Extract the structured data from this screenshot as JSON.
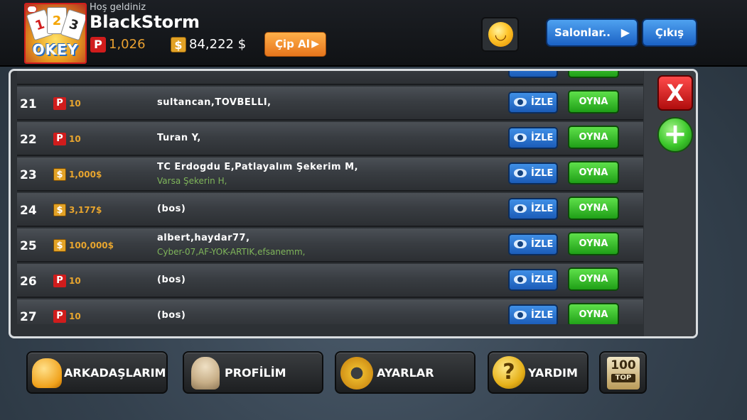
{
  "header": {
    "logo_text": "OKEY",
    "logo_cards": [
      "1",
      "2",
      "3"
    ],
    "welcome": "Hoş geldiniz",
    "username": "BlackStorm",
    "points_icon": "P",
    "points": "1,026",
    "money_icon": "$",
    "money": "84,222 $",
    "chip_button": "Çip Al",
    "salons_button": "Salonlar..",
    "logout_button": "Çıkış"
  },
  "tables": [
    {
      "num": "21",
      "currency": "P",
      "stake": "10",
      "players": "sultancan,TOVBELLI,",
      "watchers": ""
    },
    {
      "num": "22",
      "currency": "P",
      "stake": "10",
      "players": "Turan Y,",
      "watchers": ""
    },
    {
      "num": "23",
      "currency": "$",
      "stake": "1,000$",
      "players": "TC Erdogdu E,Patlayalım Şekerim M,",
      "watchers": "Varsa Şekerin H,"
    },
    {
      "num": "24",
      "currency": "$",
      "stake": "3,177$",
      "players": "(bos)",
      "watchers": ""
    },
    {
      "num": "25",
      "currency": "$",
      "stake": "100,000$",
      "players": "albert,haydar77,",
      "watchers": "Cyber-07,AF-YOK-ARTIK,efsanemm,"
    },
    {
      "num": "26",
      "currency": "P",
      "stake": "10",
      "players": "(bos)",
      "watchers": ""
    },
    {
      "num": "27",
      "currency": "P",
      "stake": "10",
      "players": "(bos)",
      "watchers": ""
    }
  ],
  "row_actions": {
    "watch": "İZLE",
    "play": "OYNA"
  },
  "side": {
    "close": "X",
    "add": "+"
  },
  "bottom": {
    "friends": "ARKADAŞLARIM",
    "profile": "PROFİLİM",
    "settings": "AYARLAR",
    "help": "YARDIM",
    "help_glyph": "?",
    "top_num": "100",
    "top_label": "TOP"
  }
}
